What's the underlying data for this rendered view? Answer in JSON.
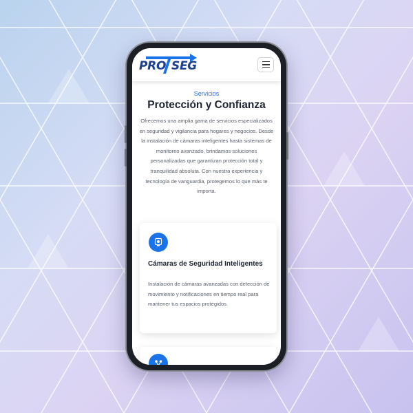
{
  "brand": {
    "logo_left": "PRO",
    "logo_right": "SEG",
    "primary_color": "#1a73e8",
    "logo_color": "#1c3f8f"
  },
  "header": {
    "menu_icon": "hamburger-menu-icon"
  },
  "hero": {
    "eyebrow": "Servicios",
    "title": "Protección y Confianza",
    "intro": "Ofrecemos una amplia gama de servicios especializados en seguridad y vigilancia para hogares y negocios. Desde la instalación de cámaras inteligentes hasta sistemas de monitoreo avanzado, brindamos soluciones personalizadas que garantizan protección total y tranquilidad absoluta. Con nuestra experiencia y tecnología de vanguardia, protegemos lo que más te importa."
  },
  "services": [
    {
      "icon": "camera-icon",
      "title": "Cámaras de Seguridad Inteligentes",
      "text": "Instalación de cámaras avanzadas con detección de movimiento y notificaciones en tiempo real para mantener tus espacios protegidos."
    },
    {
      "icon": "network-icon"
    }
  ]
}
